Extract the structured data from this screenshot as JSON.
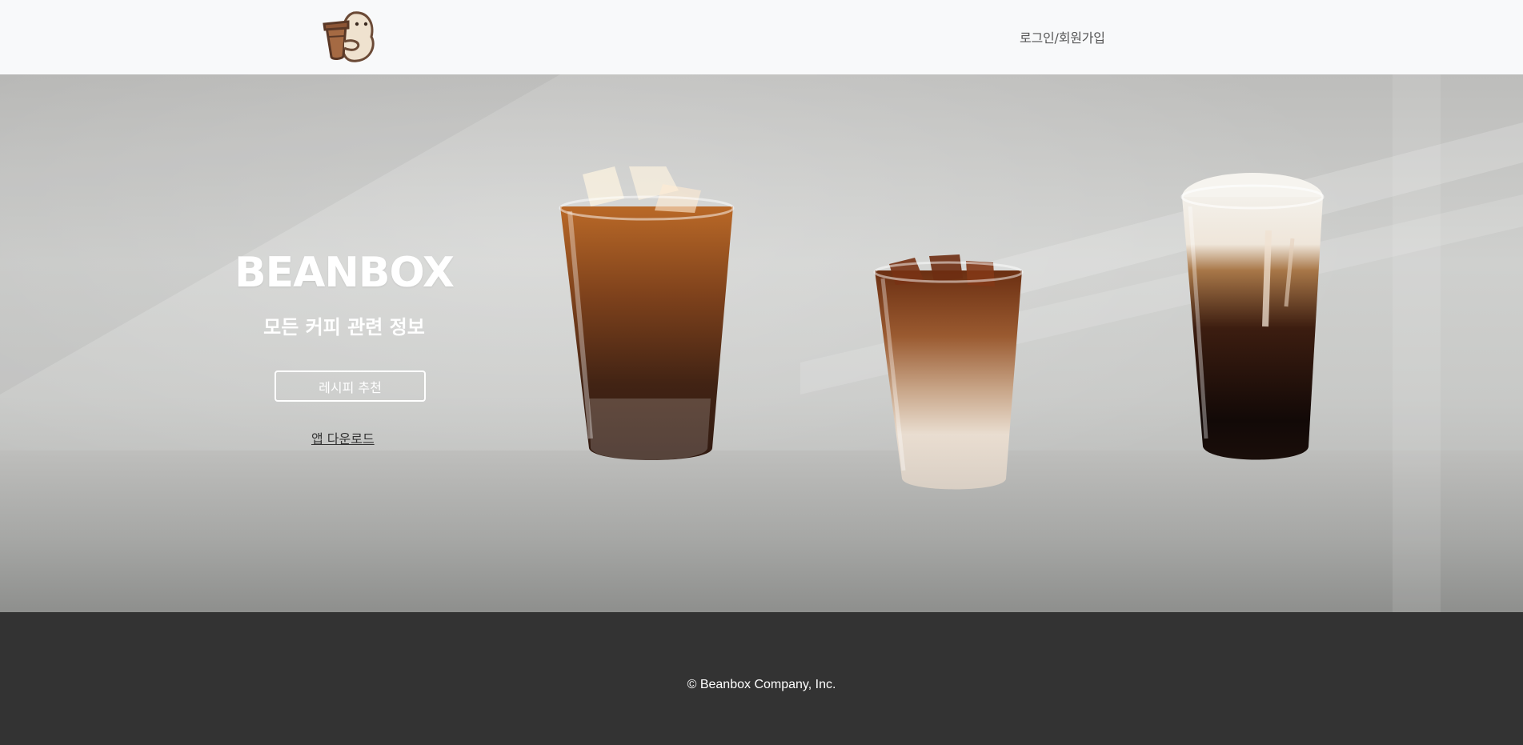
{
  "header": {
    "logo_icon": "bean-mascot-holding-coffee-cup-icon",
    "login_label": "로그인/회원가입"
  },
  "hero": {
    "brand": "BEANBOX",
    "tagline": "모든 커피 관련 정보",
    "recipe_button": "레시피 추천",
    "app_download": "앱 다운로드",
    "images": [
      "iced-americano",
      "iced-latte",
      "cream-cold-brew"
    ]
  },
  "footer": {
    "copyright": "© Beanbox Company, Inc."
  },
  "colors": {
    "header_bg": "#f8f9fa",
    "footer_bg": "#333333",
    "hero_text": "#ffffff"
  }
}
